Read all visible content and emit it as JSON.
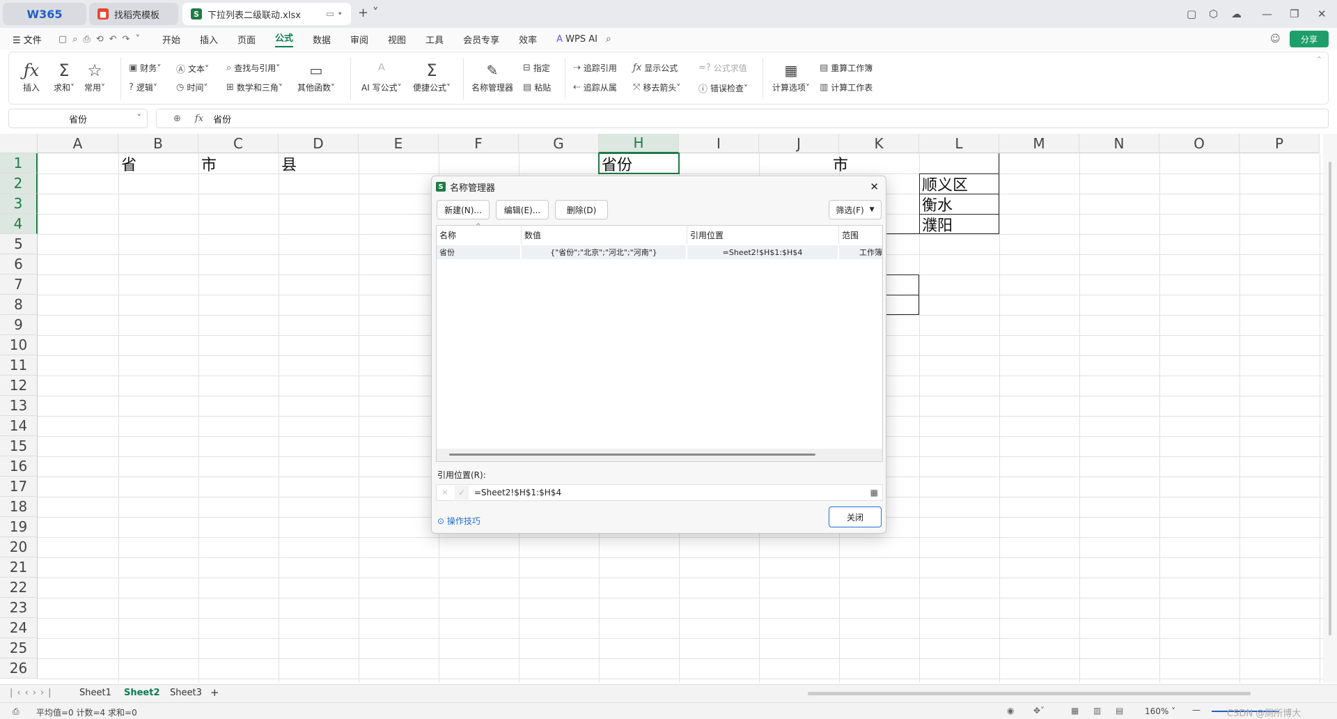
{
  "tabs": [
    {
      "label": "W365"
    },
    {
      "label": "找稻壳模板"
    },
    {
      "label": "下拉列表二级联动.xlsx"
    }
  ],
  "menu": {
    "file": "文件",
    "items": [
      "开始",
      "插入",
      "页面",
      "公式",
      "数据",
      "审阅",
      "视图",
      "工具",
      "会员专享",
      "效率"
    ],
    "wps_ai": "WPS AI",
    "share": "分享"
  },
  "ribbon": {
    "insert": "插入",
    "sum": "求和",
    "common": "常用",
    "finance": "财务",
    "text": "文本",
    "lookup": "查找与引用",
    "logic": "逻辑",
    "time": "时间",
    "math": "数学和三角",
    "other": "其他函数",
    "ai_formula": "AI 写公式",
    "quick_formula": "便捷公式",
    "name_manager": "名称管理器",
    "specify": "指定",
    "paste": "粘贴",
    "trace_precedents": "追踪引用",
    "show_formula": "显示公式",
    "eval_formula": "公式求值",
    "trace_dependents": "追踪从属",
    "remove_arrows": "移去箭头",
    "error_check": "错误检查",
    "calc_options": "计算选项",
    "recalc_workbook": "重算工作簿",
    "calc_sheet": "计算工作表"
  },
  "formula_bar": {
    "name_box": "省份",
    "fx": "fx",
    "content": "省份"
  },
  "columns": [
    "A",
    "B",
    "C",
    "D",
    "E",
    "F",
    "G",
    "H",
    "I",
    "J",
    "K",
    "L",
    "M",
    "N",
    "O",
    "P"
  ],
  "rows": [
    "1",
    "2",
    "3",
    "4",
    "5",
    "6",
    "7",
    "8",
    "9",
    "10",
    "11",
    "12",
    "13",
    "14",
    "15",
    "16",
    "17",
    "18",
    "19",
    "20",
    "21",
    "22",
    "23",
    "24",
    "25",
    "26"
  ],
  "cells": {
    "B1": "省",
    "C1": "市",
    "D1": "县",
    "H1": "省份",
    "J1": "市",
    "L2": "顺义区",
    "L3": "衡水",
    "L4": "濮阳"
  },
  "sheets": [
    "Sheet1",
    "Sheet2",
    "Sheet3"
  ],
  "status": {
    "text": "平均值=0  计数=4  求和=0",
    "zoom": "160%",
    "watermark": "CSDN @厕所博大"
  },
  "dialog": {
    "title": "名称管理器",
    "new_btn": "新建(N)...",
    "edit_btn": "编辑(E)...",
    "delete_btn": "删除(D)",
    "filter_btn": "筛选(F)",
    "headers": [
      "名称",
      "数值",
      "引用位置",
      "范围"
    ],
    "rows": [
      {
        "name": "省份",
        "value": "{\"省份\";\"北京\";\"河北\";\"河南\"}",
        "ref": "=Sheet2!$H$1:$H$4",
        "scope": "工作簿"
      }
    ],
    "ref_label": "引用位置(R):",
    "ref_value": "=Sheet2!$H$1:$H$4",
    "tips": "操作技巧",
    "close_btn": "关闭"
  }
}
